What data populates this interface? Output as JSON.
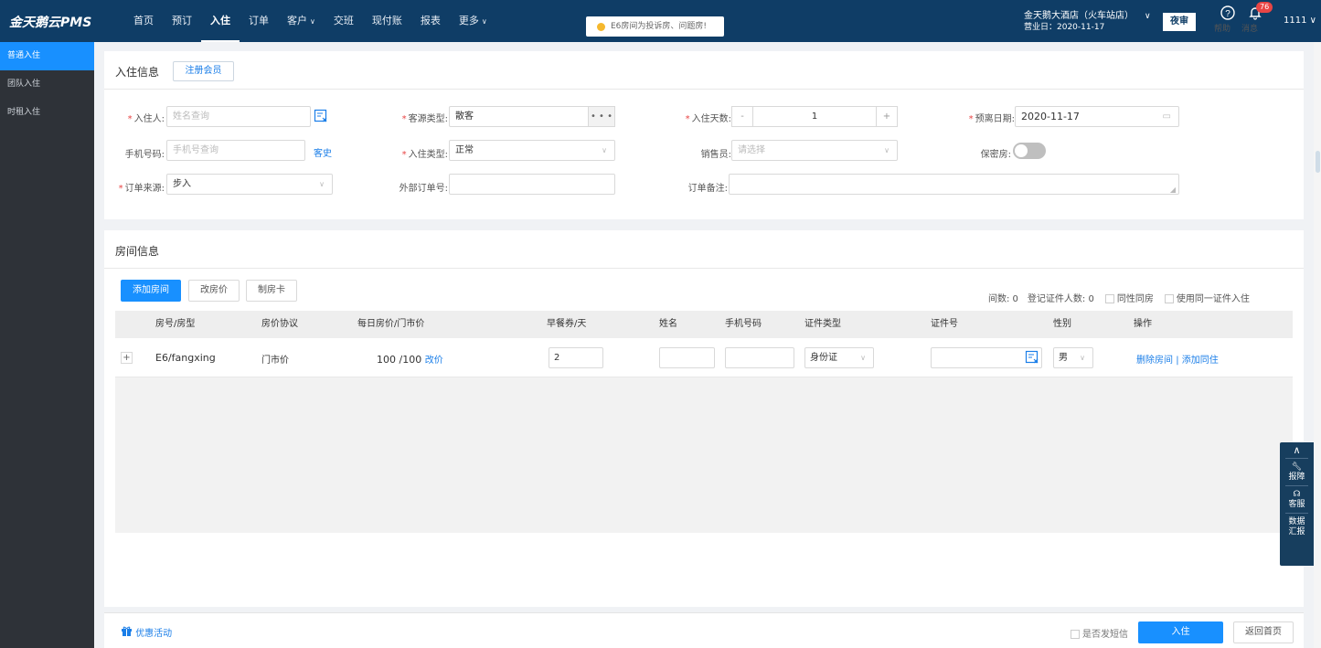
{
  "app": {
    "logo": "金天鹅云PMS"
  },
  "nav": {
    "items": [
      {
        "label": "首页",
        "caret": ""
      },
      {
        "label": "预订",
        "caret": ""
      },
      {
        "label": "入住",
        "caret": ""
      },
      {
        "label": "订单",
        "caret": ""
      },
      {
        "label": "客户",
        "caret": "∨"
      },
      {
        "label": "交班",
        "caret": ""
      },
      {
        "label": "现付账",
        "caret": ""
      },
      {
        "label": "报表",
        "caret": ""
      },
      {
        "label": "更多",
        "caret": "∨"
      }
    ],
    "active": "入住",
    "notice": "E6房间为投诉房、问题房!",
    "hotel_name": "金天鹅大酒店（火车站店）",
    "business_day": "营业日：2020-11-17",
    "audit_label": "夜审",
    "help_label": "帮助",
    "msg_label": "消息",
    "msg_count": "76",
    "user": "1111 ∨"
  },
  "sidebar": {
    "items": [
      "普通入住",
      "团队入住",
      "时租入住"
    ],
    "active": "普通入住"
  },
  "checkin": {
    "title": "入住信息",
    "register_label": "注册会员",
    "guest_label": "入住人:",
    "guest_placeholder": "姓名查询",
    "phone_label": "手机号码:",
    "phone_placeholder": "手机号查询",
    "history_label": "客史",
    "source_label": "订单来源:",
    "source_value": "步入",
    "guest_type_label": "客源类型:",
    "guest_type_value": "散客",
    "guest_type_more": "• • •",
    "checkin_type_label": "入住类型:",
    "checkin_type_value": "正常",
    "ext_order_label": "外部订单号:",
    "days_label": "入住天数:",
    "days_minus": "-",
    "days_value": "1",
    "days_plus": "+",
    "sales_label": "销售员:",
    "sales_placeholder": "请选择",
    "remark_label": "订单备注:",
    "leave_label": "预离日期:",
    "leave_value": "2020-11-17",
    "secret_label": "保密房:"
  },
  "rooms": {
    "title": "房间信息",
    "add_room": "添加房间",
    "change_price": "改房价",
    "make_card": "制房卡",
    "room_count": "间数: 0",
    "cert_count": "登记证件人数: 0",
    "same_gender": "同性同房",
    "same_cert": "使用同一证件入住",
    "columns": [
      "房号/房型",
      "房价协议",
      "每日房价/门市价",
      "早餐券/天",
      "姓名",
      "手机号码",
      "证件类型",
      "证件号",
      "性别",
      "操作"
    ],
    "rows": [
      {
        "expand": "+",
        "room": "E6/fangxing",
        "agreement": "门市价",
        "price": "100 /100",
        "price_link": "改价",
        "breakfast": "2",
        "cert_type": "身份证",
        "gender": "男",
        "delete": "删除房间",
        "sep": "|",
        "add_guest": "添加同住"
      }
    ]
  },
  "footer": {
    "promo": "优惠活动",
    "sms_label": "是否发短信",
    "checkin_btn": "入住",
    "back_btn": "返回首页"
  },
  "float": {
    "repair": "报障",
    "service": "客服",
    "report": "数据汇报"
  }
}
